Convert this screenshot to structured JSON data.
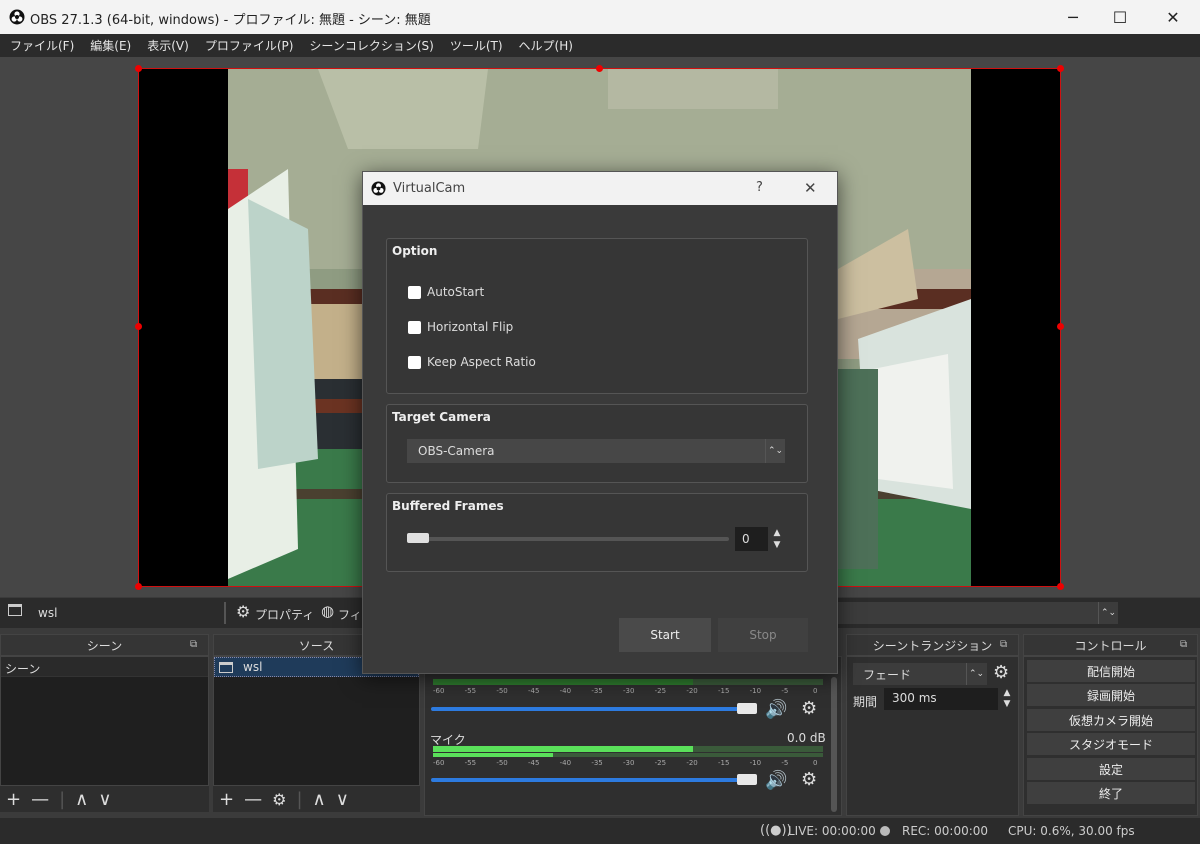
{
  "window": {
    "title": "OBS 27.1.3 (64-bit, windows) - プロファイル: 無題 - シーン: 無題",
    "minimize": "─",
    "maximize": "☐",
    "close": "✕"
  },
  "menu": [
    "ファイル(F)",
    "編集(E)",
    "表示(V)",
    "プロファイル(P)",
    "シーンコレクション(S)",
    "ツール(T)",
    "ヘルプ(H)"
  ],
  "source_toolbar": {
    "source_name": "wsl",
    "properties": "プロパティ",
    "filters": "フィル"
  },
  "docks": {
    "scenes": {
      "title": "シーン",
      "items": [
        "シーン"
      ]
    },
    "sources": {
      "title": "ソース",
      "items": [
        "wsl"
      ]
    },
    "transitions": {
      "title": "シーントランジション",
      "selected": "フェード",
      "duration_label": "期間",
      "duration_value": "300 ms"
    },
    "controls": {
      "title": "コントロール",
      "buttons": [
        "配信開始",
        "録画開始",
        "仮想カメラ開始",
        "スタジオモード",
        "設定",
        "終了"
      ]
    }
  },
  "mixer": {
    "ticks": [
      "-60",
      "-55",
      "-50",
      "-45",
      "-40",
      "-35",
      "-30",
      "-25",
      "-20",
      "-15",
      "-10",
      "-5",
      "0"
    ],
    "tracks": [
      {
        "name": "",
        "level": "",
        "volume": 1.0
      },
      {
        "name": "マイク",
        "level": "0.0 dB",
        "volume": 1.0
      }
    ]
  },
  "status": {
    "live": "LIVE: 00:00:00",
    "rec": "REC: 00:00:00",
    "cpu": "CPU: 0.6%, 30.00 fps"
  },
  "dialog": {
    "title": "VirtualCam",
    "help": "?",
    "close": "✕",
    "option_title": "Option",
    "options": [
      "AutoStart",
      "Horizontal Flip",
      "Keep Aspect Ratio"
    ],
    "target_title": "Target Camera",
    "target_value": "OBS-Camera",
    "buffered_title": "Buffered Frames",
    "buffered_value": "0",
    "start": "Start",
    "stop": "Stop"
  },
  "colors": {
    "accent": "#2d7be0",
    "selection": "#d01010",
    "panel": "#2b2b2b"
  }
}
